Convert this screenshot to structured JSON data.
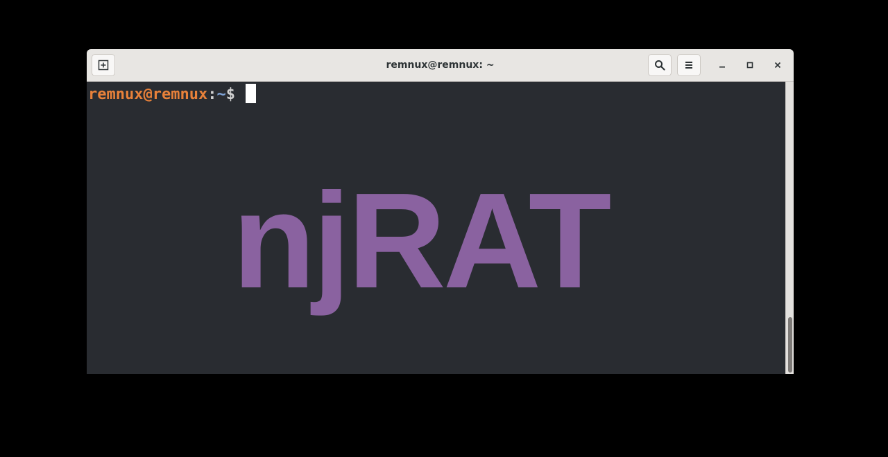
{
  "window": {
    "title": "remnux@remnux: ~"
  },
  "titlebar": {
    "new_tab_icon": "new-tab-icon",
    "search_icon": "search-icon",
    "menu_icon": "hamburger-menu-icon",
    "minimize_icon": "minimize-icon",
    "maximize_icon": "maximize-icon",
    "close_icon": "close-icon"
  },
  "terminal": {
    "prompt_user": "remnux@remnux",
    "prompt_colon": ":",
    "prompt_path": "~",
    "prompt_symbol": "$ ",
    "watermark": "njRAT"
  },
  "colors": {
    "terminal_bg": "#292c31",
    "user_color": "#e8813a",
    "path_color": "#7fa3d6",
    "watermark_color": "#8a62a0"
  }
}
